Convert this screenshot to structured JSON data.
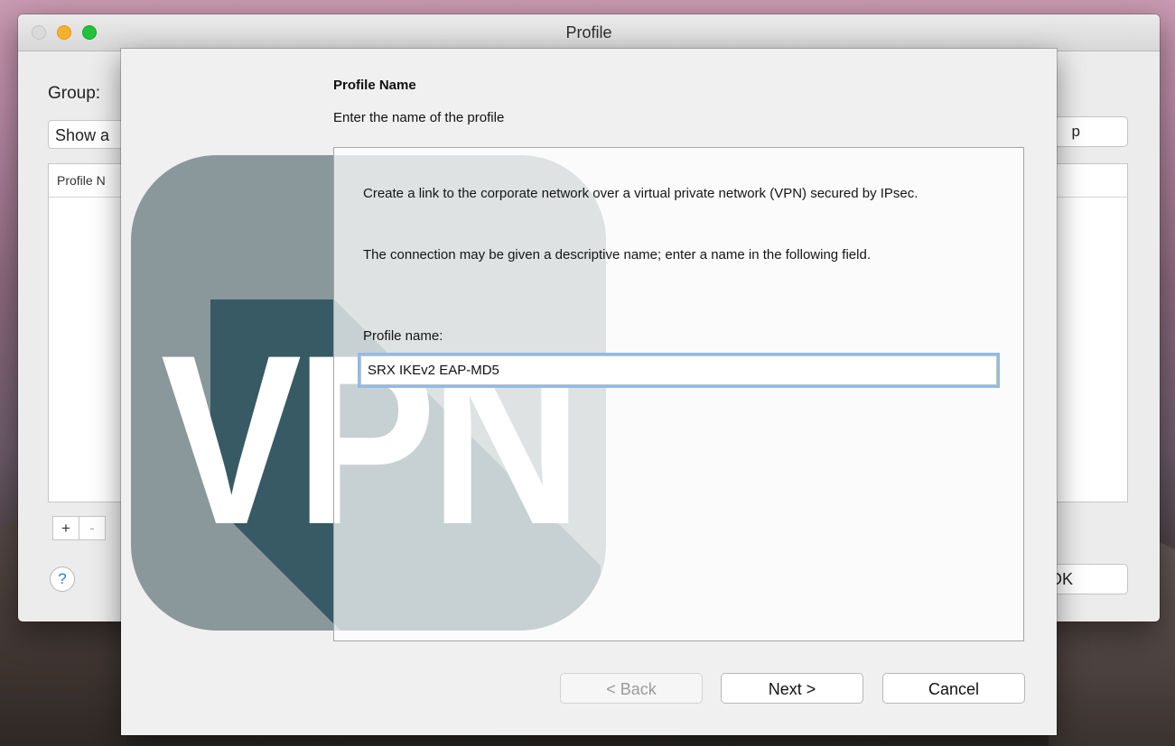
{
  "window": {
    "title": "Profile",
    "group_label": "Group:",
    "group_select_value": "Show a",
    "list_header": "Profile N",
    "plus_label": "+",
    "minus_label": "-",
    "help_label": "?",
    "right_button_fragment": "p",
    "ok_button_fragment": "OK"
  },
  "wizard": {
    "title": "Profile Name",
    "subtitle": "Enter the name of the profile",
    "logo_text": "VPN",
    "paragraph1": "Create a link to the corporate network over a virtual private network (VPN) secured by IPsec.",
    "paragraph2": "The connection may be given a descriptive name; enter a name in the following field.",
    "profile_name_label": "Profile name:",
    "profile_name_value": "SRX IKEv2 EAP-MD5",
    "back_label": "< Back",
    "next_label": "Next >",
    "cancel_label": "Cancel"
  },
  "colors": {
    "logo_light": "#8a989c",
    "logo_dark": "#375a65",
    "focus_ring": "#8fbce8",
    "traffic_close": "#dadada",
    "traffic_minimize": "#f6b12a",
    "traffic_maximize": "#23c23c"
  },
  "icons": {
    "help": "question-mark-icon",
    "logo": "vpn-logo-icon"
  }
}
